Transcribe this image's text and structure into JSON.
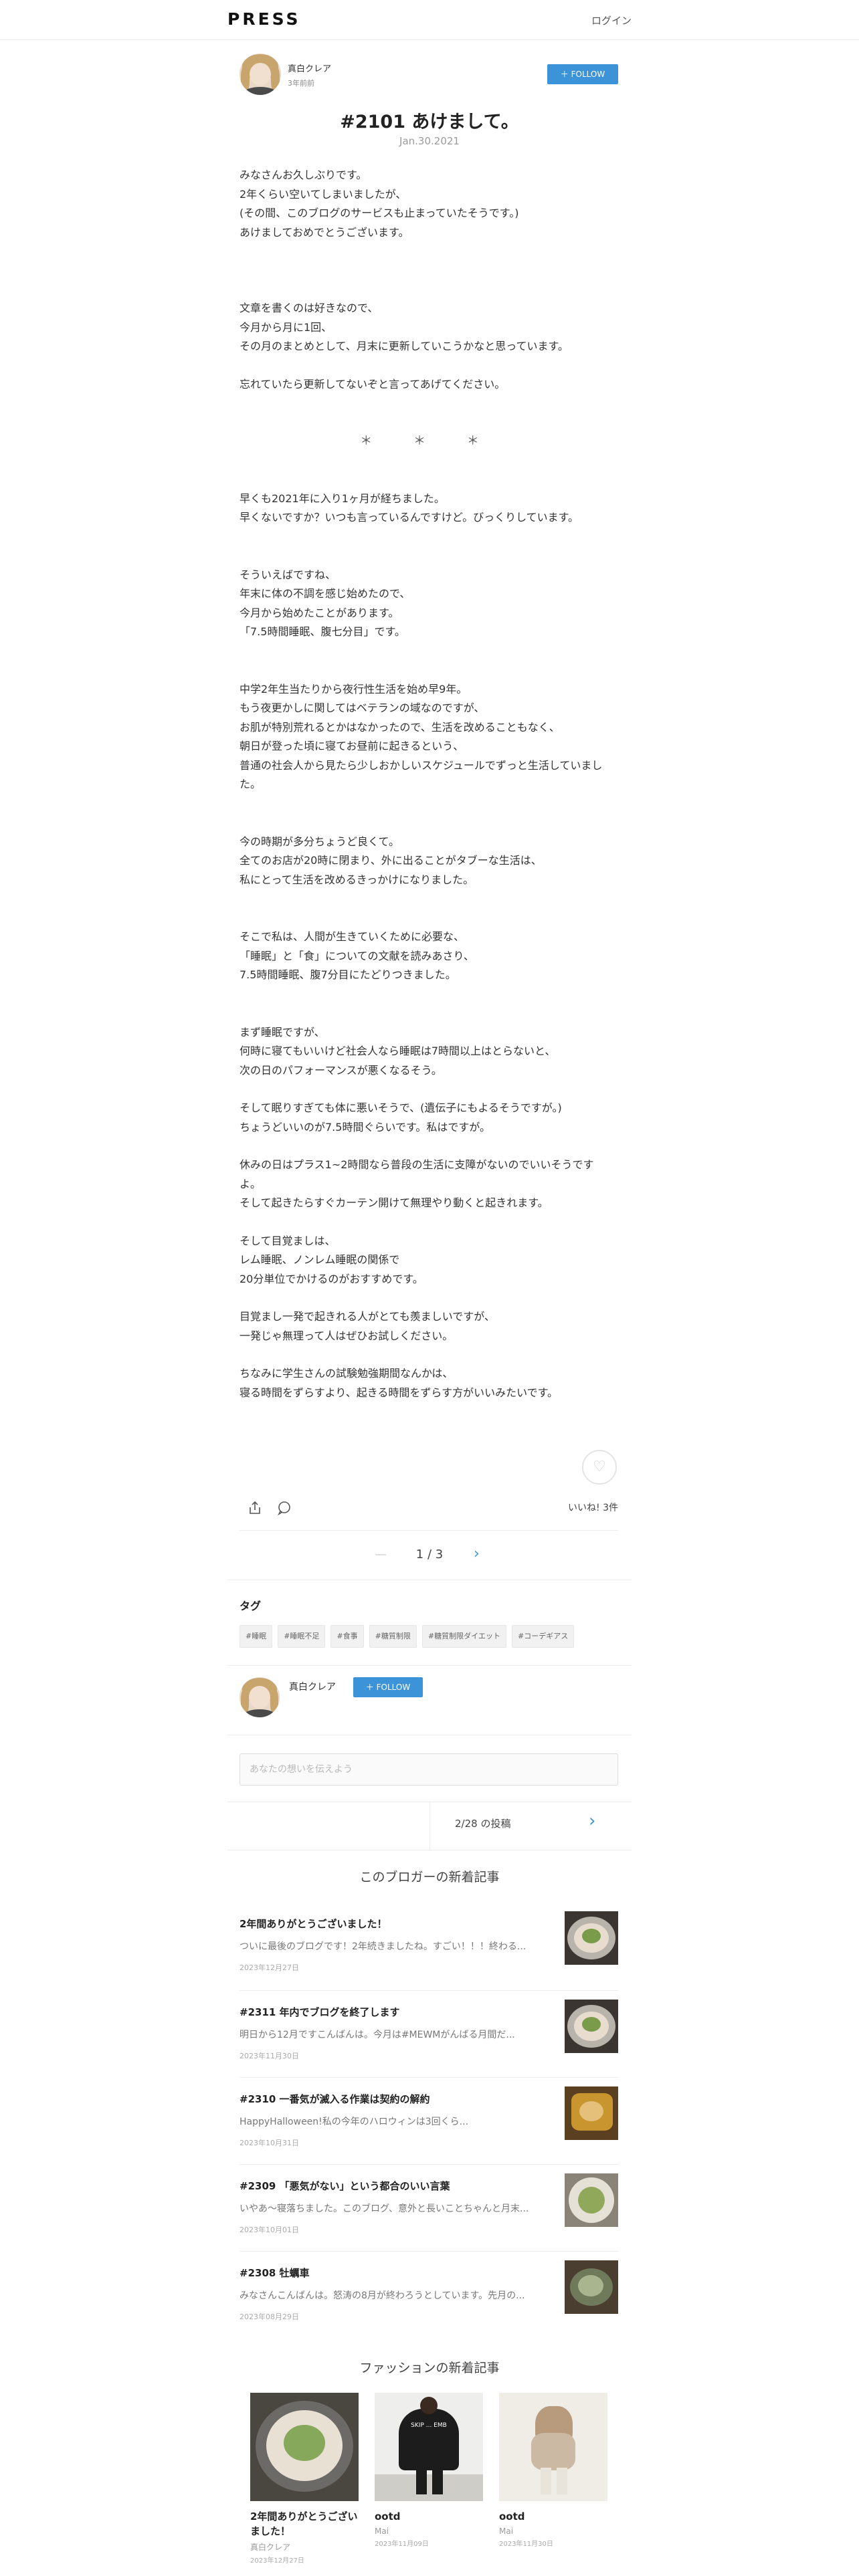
{
  "header": {
    "logo": "PRESS",
    "login": "ログイン"
  },
  "author": {
    "name": "真白クレア",
    "time_ago": "3年前前",
    "follow_label": "＋ FOLLOW"
  },
  "post": {
    "title": "#2101 あけまして。",
    "date": "Jan.30.2021",
    "para1": "みなさんお久しぶりです。\n2年くらい空いてしまいましたが、\n(その間、このブログのサービスも止まっていたそうです。)\nあけましておめでとうございます。",
    "para2": "文章を書くのは好きなので、\n今月から月に1回、\nその月のまとめとして、月末に更新していこうかなと思っています。",
    "para3": "忘れていたら更新してないぞと言ってあげてください。",
    "stars": "＊ ＊ ＊",
    "para4": "早くも2021年に入り1ヶ月が経ちました。\n早くないですか？いつも言っているんですけど。びっくりしています。",
    "para5": "そういえばですね、\n年末に体の不調を感じ始めたので、\n今月から始めたことがあります。\n「7.5時間睡眠、腹七分目」です。",
    "para6": "中学2年生当たりから夜行性生活を始め早9年。\nもう夜更かしに関してはベテランの域なのですが、\nお肌が特別荒れるとかはなかったので、生活を改めることもなく、\n朝日が登った頃に寝てお昼前に起きるという、\n普通の社会人から見たら少しおかしいスケジュールでずっと生活していました。",
    "para7": "今の時期が多分ちょうど良くて。\n全てのお店が20時に閉まり、外に出ることがタブーな生活は、\n私にとって生活を改めるきっかけになりました。",
    "para8": "そこで私は、人間が生きていくために必要な、\n「睡眠」と「食」についての文献を読みあさり、\n7.5時間睡眠、腹7分目にたどりつきました。",
    "para9": "まず睡眠ですが、\n何時に寝てもいいけど社会人なら睡眠は7時間以上はとらないと、\n次の日のパフォーマンスが悪くなるそう。",
    "para10": "そして眠りすぎても体に悪いそうで、(遺伝子にもよるそうですが。)\nちょうどいいのが7.5時間ぐらいです。私はですが。",
    "para11": "休みの日はプラス1~2時間なら普段の生活に支障がないのでいいそうです\nよ。\nそして起きたらすぐカーテン開けて無理やり動くと起きれます。",
    "para12": "そして目覚ましは、\nレム睡眠、ノンレム睡眠の関係で\n20分単位でかけるのがおすすめです。",
    "para13": "目覚まし一発で起きれる人がとても羨ましいですが、\n一発じゃ無理って人はぜひお試しください。",
    "para14": "ちなみに学生さんの試験勉強期間なんかは、\n寝る時間をずらすより、起きる時間をずらす方がいいみたいです。"
  },
  "actions": {
    "like_count": "いいね! 3件",
    "share_icon": "share-icon",
    "comment_icon": "comment-icon",
    "heart_icon": "heart-icon"
  },
  "pagination": {
    "label": "1 / 3"
  },
  "tags": {
    "label": "タグ",
    "items": [
      "#睡眠",
      "#睡眠不足",
      "#食事",
      "#糖質制限",
      "#糖質制限ダイエット",
      "#コーデギアス"
    ]
  },
  "comment": {
    "placeholder": "あなたの想いを伝えよう"
  },
  "post_nav": {
    "count": "2/28 の投稿"
  },
  "recent": {
    "title": "このブロガーの新着記事",
    "items": [
      {
        "title": "2年間ありがとうございました！",
        "excerpt": "ついに最後のブログです！2年続きましたね。すごい！！！終わる...",
        "date": "2023年12月27日"
      },
      {
        "title": "#2311 年内でブログを終了します",
        "excerpt": "明日から12月ですこんばんは。今月は#MEWMがんばる月間だ...",
        "date": "2023年11月30日"
      },
      {
        "title": "#2310 一番気が滅入る作業は契約の解約",
        "excerpt": "HappyHalloween!私の今年のハロウィンは3回くら...",
        "date": "2023年10月31日"
      },
      {
        "title": "#2309 「悪気がない」という都合のいい言葉",
        "excerpt": "いやあ〜寝落ちました。このブログ、意外と長いことちゃんと月末...",
        "date": "2023年10月01日"
      },
      {
        "title": "#2308 牡蠣車",
        "excerpt": "みなさんこんばんは。怒涛の8月が終わろうとしています。先月の...",
        "date": "2023年08月29日"
      }
    ]
  },
  "fashion": {
    "title": "ファッションの新着記事",
    "cards": [
      {
        "title": "2年間ありがとうございました！",
        "author": "真白クレア",
        "date": "2023年12月27日"
      },
      {
        "title": "ootd",
        "author": "Mai",
        "date": "2023年11月09日"
      },
      {
        "title": "ootd",
        "author": "Mai",
        "date": "2023年11月30日"
      }
    ],
    "shirt_print": "SKIP ... EMB"
  }
}
